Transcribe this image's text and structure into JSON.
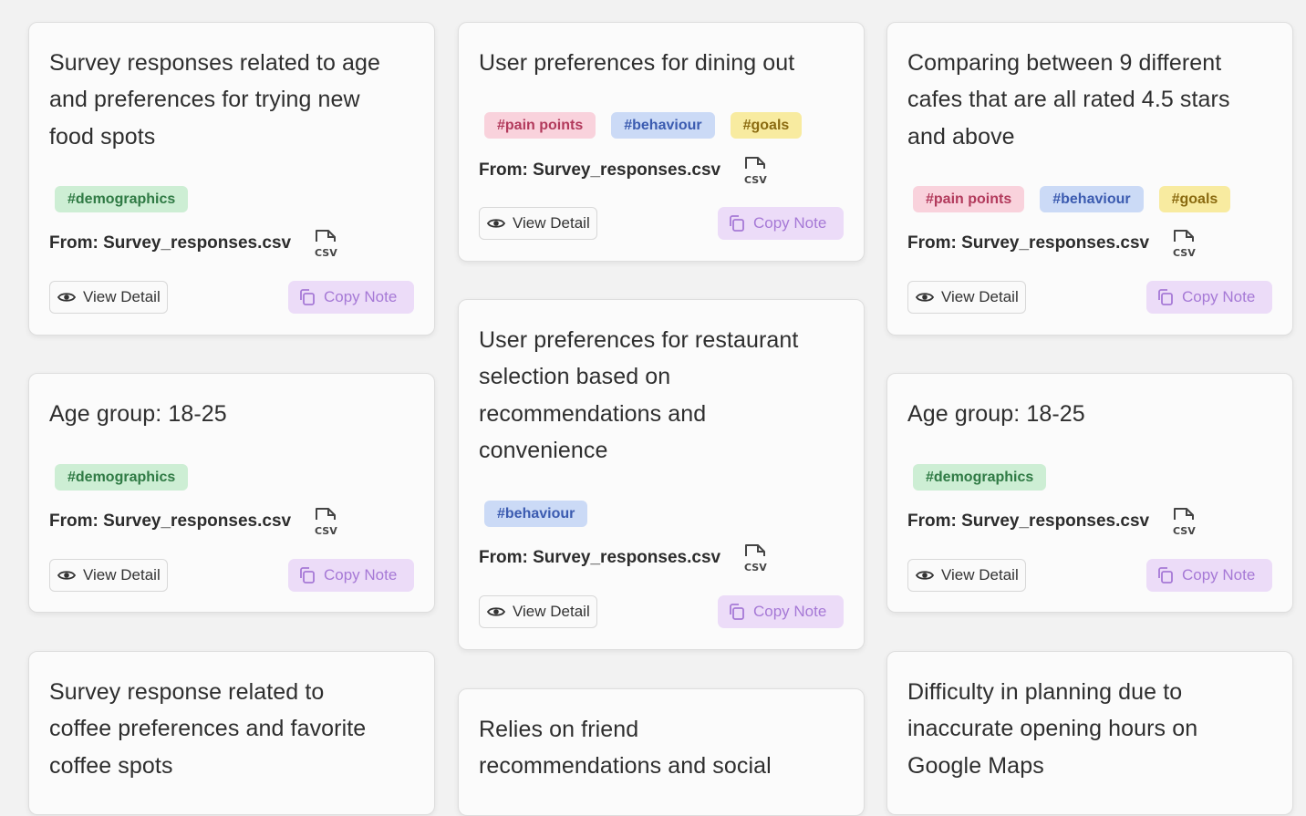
{
  "colors": {
    "background": "#f2f2f2",
    "tag_pink": "#f9d2dc",
    "tag_blue": "#cbdaf6",
    "tag_yellow": "#f8eba0",
    "tag_green": "#cdeed4",
    "copy_button": "#ecdcf8"
  },
  "icons": {
    "file": "csv-file-icon",
    "view": "eye-icon",
    "copy": "copy-icon"
  },
  "labels": {
    "view_detail": "View Detail",
    "copy_note": "Copy Note",
    "csv": "CSV"
  },
  "cards": [
    {
      "title_lines": [
        "Survey responses related to age",
        "and preferences for trying new",
        "food spots"
      ],
      "tags": [
        {
          "label": "#demographics",
          "color": "green"
        }
      ],
      "source": "From: Survey_responses.csv"
    },
    {
      "title_lines": [
        "User preferences for dining out"
      ],
      "tags": [
        {
          "label": "#pain points",
          "color": "pink"
        },
        {
          "label": "#behaviour",
          "color": "blue"
        },
        {
          "label": "#goals",
          "color": "yellow"
        }
      ],
      "source": "From: Survey_responses.csv"
    },
    {
      "title_lines": [
        "Comparing between 9 different",
        "cafes that are all rated 4.5 stars",
        "and above"
      ],
      "tags": [
        {
          "label": "#pain points",
          "color": "pink"
        },
        {
          "label": "#behaviour",
          "color": "blue"
        },
        {
          "label": "#goals",
          "color": "yellow"
        }
      ],
      "source": "From: Survey_responses.csv"
    },
    {
      "title_lines": [
        "Age group: 18-25"
      ],
      "tags": [
        {
          "label": "#demographics",
          "color": "green"
        }
      ],
      "source": "From: Survey_responses.csv"
    },
    {
      "title_lines": [
        "User preferences for restaurant",
        "selection based on",
        "recommendations and",
        "convenience"
      ],
      "tags": [
        {
          "label": "#behaviour",
          "color": "blue"
        }
      ],
      "source": "From: Survey_responses.csv"
    },
    {
      "title_lines": [
        "Age group: 18-25"
      ],
      "tags": [
        {
          "label": "#demographics",
          "color": "green"
        }
      ],
      "source": "From: Survey_responses.csv"
    },
    {
      "title_lines": [
        "Survey response related to",
        "coffee preferences and favorite",
        "coffee spots"
      ],
      "tags": [],
      "source": ""
    },
    {
      "title_lines": [
        "Relies on friend",
        "recommendations and social"
      ],
      "tags": [],
      "source": ""
    },
    {
      "title_lines": [
        "Difficulty in planning due to",
        "inaccurate opening hours on",
        "Google Maps"
      ],
      "tags": [],
      "source": ""
    }
  ]
}
